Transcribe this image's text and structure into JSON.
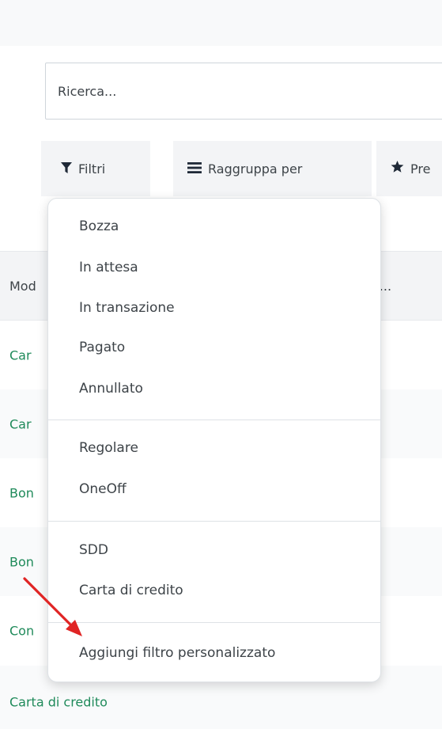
{
  "search": {
    "placeholder": "Ricerca..."
  },
  "toolbar": {
    "filters_label": "Filtri",
    "group_label": "Raggruppa per",
    "favorites_label": "Pre"
  },
  "table": {
    "headers": [
      "Mod",
      "a..."
    ],
    "rows": [
      "Car",
      "Car",
      "Bon",
      "Bon",
      "Con",
      "Carta di credito"
    ]
  },
  "filter_menu": {
    "section1": [
      "Bozza",
      "In attesa",
      "In transazione",
      "Pagato",
      "Annullato"
    ],
    "section2": [
      "Regolare",
      "OneOff"
    ],
    "section3": [
      "SDD",
      "Carta di credito"
    ],
    "custom_filter": "Aggiungi filtro personalizzato"
  },
  "colors": {
    "link_green": "#1f8a5a",
    "annotation_red": "#e02424"
  },
  "icons": {
    "filters": "filter-icon",
    "group": "group-by-icon",
    "favorites": "star-icon"
  }
}
